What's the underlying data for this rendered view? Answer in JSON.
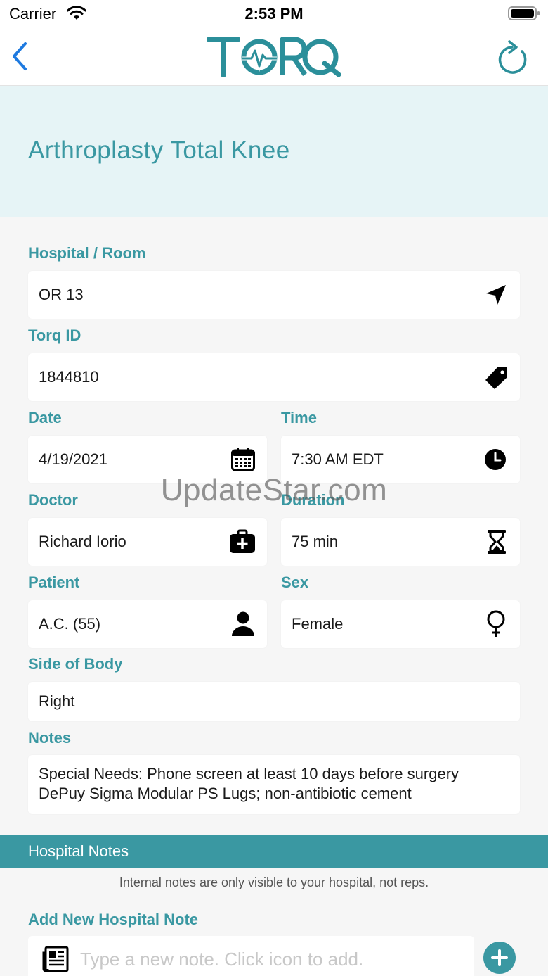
{
  "status": {
    "carrier": "Carrier",
    "time": "2:53 PM"
  },
  "nav": {
    "logo": "TORQ"
  },
  "procedure": {
    "title": "Arthroplasty Total Knee"
  },
  "fields": {
    "hospital_room": {
      "label": "Hospital / Room",
      "value": "OR 13",
      "icon": "location-arrow-icon"
    },
    "torq_id": {
      "label": "Torq ID",
      "value": "1844810",
      "icon": "tag-icon"
    },
    "date": {
      "label": "Date",
      "value": "4/19/2021",
      "icon": "calendar-icon"
    },
    "time": {
      "label": "Time",
      "value": "7:30 AM EDT",
      "icon": "clock-icon"
    },
    "doctor": {
      "label": "Doctor",
      "value": "Richard Iorio",
      "icon": "medical-bag-icon"
    },
    "duration": {
      "label": "Duration",
      "value": "75 min",
      "icon": "hourglass-icon"
    },
    "patient": {
      "label": "Patient",
      "value": "A.C. (55)",
      "icon": "person-icon"
    },
    "sex": {
      "label": "Sex",
      "value": "Female",
      "icon": "female-icon"
    },
    "side": {
      "label": "Side of Body",
      "value": "Right"
    },
    "notes": {
      "label": "Notes",
      "line1": "Special Needs: Phone screen at least 10 days before surgery",
      "line2": "DePuy Sigma Modular PS Lugs; non-antibiotic cement"
    }
  },
  "hospital_notes": {
    "section_title": "Hospital Notes",
    "info": "Internal notes are only visible to your hospital, not reps.",
    "add_label": "Add New Hospital Note",
    "placeholder": "Type a new note. Click icon to add."
  },
  "watermark": "UpdateStar.com",
  "colors": {
    "accent": "#3a98a2",
    "hero_bg": "#e6f4f6",
    "page_bg": "#f6f6f6",
    "back_blue": "#1e7ae0"
  }
}
